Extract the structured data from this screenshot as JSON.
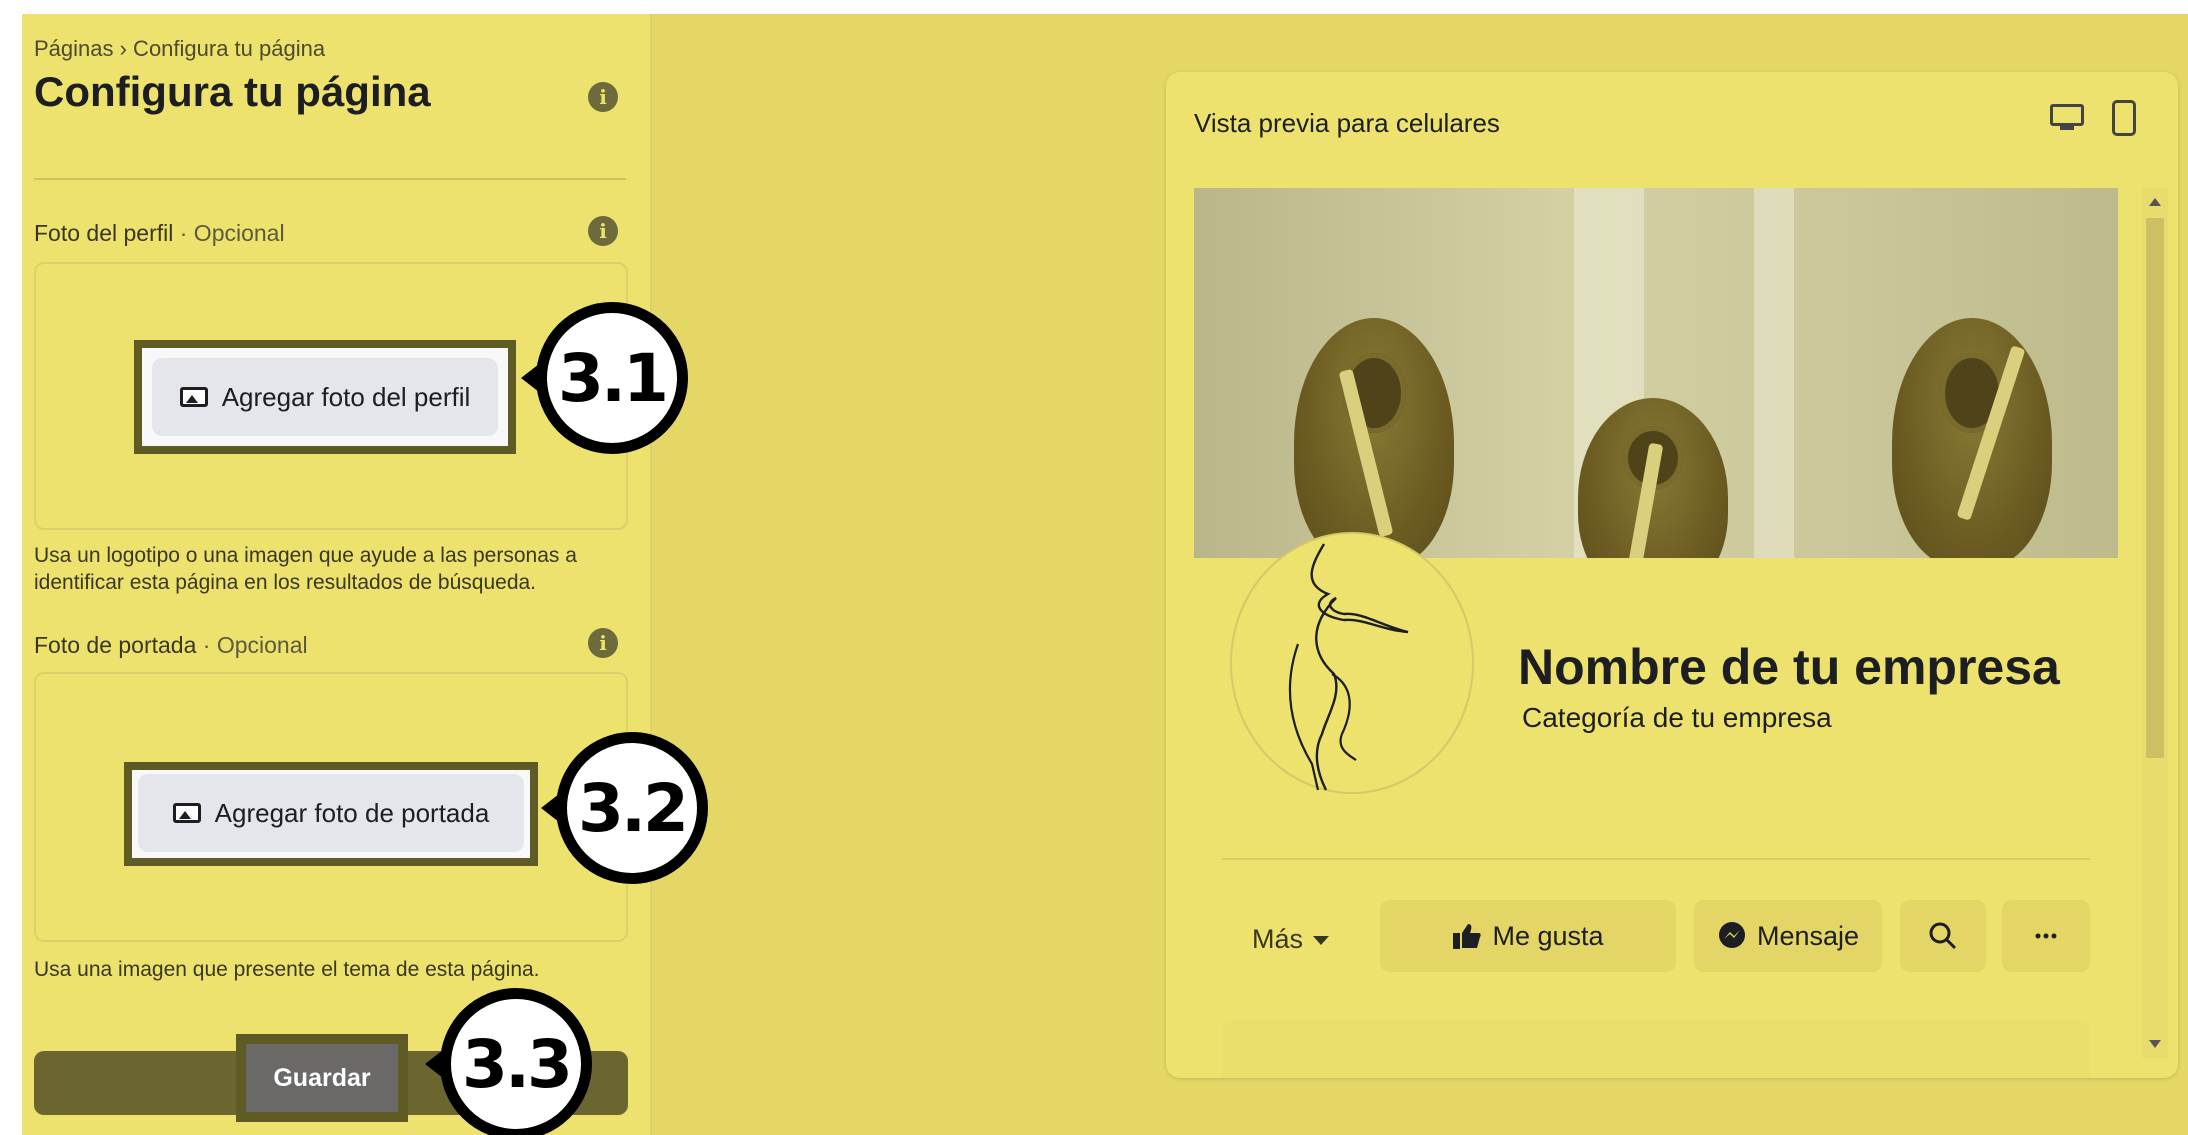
{
  "left_panel": {
    "breadcrumb": "Páginas › Configura tu página",
    "title": "Configura tu página",
    "profile_photo": {
      "label": "Foto del perfil",
      "optional": " · Opcional",
      "button": "Agregar foto del perfil",
      "help": "Usa un logotipo o una imagen que ayude a las personas a identificar esta página en los resultados de búsqueda."
    },
    "cover_photo": {
      "label": "Foto de portada",
      "optional": " · Opcional",
      "button": "Agregar foto de portada",
      "help": "Usa una imagen que presente el tema de esta página."
    },
    "save_button": "Guardar"
  },
  "callouts": [
    "3.1",
    "3.2",
    "3.3"
  ],
  "preview": {
    "title": "Vista previa para celulares",
    "business_name": "Nombre de tu empresa",
    "business_category": "Categoría de tu empresa",
    "actions": {
      "more": "Más",
      "like": "Me gusta",
      "message": "Mensaje"
    }
  },
  "colors": {
    "overlay_yellow": "#ede26e",
    "highlight_border": "#5f5b24",
    "save_gray": "#6a6968"
  }
}
